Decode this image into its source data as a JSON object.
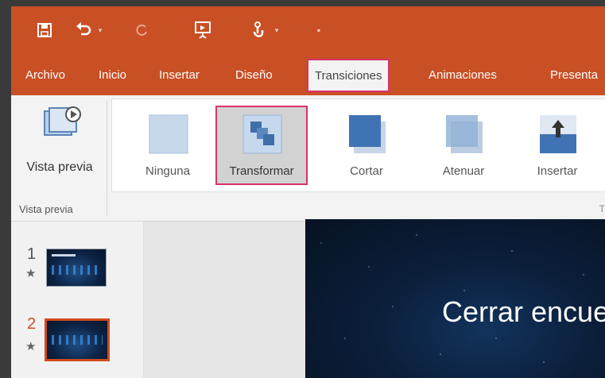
{
  "tabs": {
    "archivo": "Archivo",
    "inicio": "Inicio",
    "insertar": "Insertar",
    "diseno": "Diseño",
    "transiciones": "Transiciones",
    "animaciones": "Animaciones",
    "presentacion": "Presenta"
  },
  "ribbon": {
    "preview_label": "Vista previa",
    "group_label": "Vista previa",
    "gallery": [
      {
        "label": "Ninguna",
        "icon": "none-transition-icon"
      },
      {
        "label": "Transformar",
        "icon": "morph-transition-icon",
        "selected": true
      },
      {
        "label": "Cortar",
        "icon": "cut-transition-icon"
      },
      {
        "label": "Atenuar",
        "icon": "fade-transition-icon"
      },
      {
        "label": "Insertar",
        "icon": "push-transition-icon"
      }
    ],
    "tail": "T"
  },
  "slides": [
    {
      "number": "1",
      "star": "★"
    },
    {
      "number": "2",
      "star": "★",
      "selected": true
    }
  ],
  "slide": {
    "title": "Cerrar encuer"
  },
  "colors": {
    "ribbon_bg": "#c94f24",
    "highlight": "#d6336c",
    "selected_slide": "#d04a1f"
  }
}
